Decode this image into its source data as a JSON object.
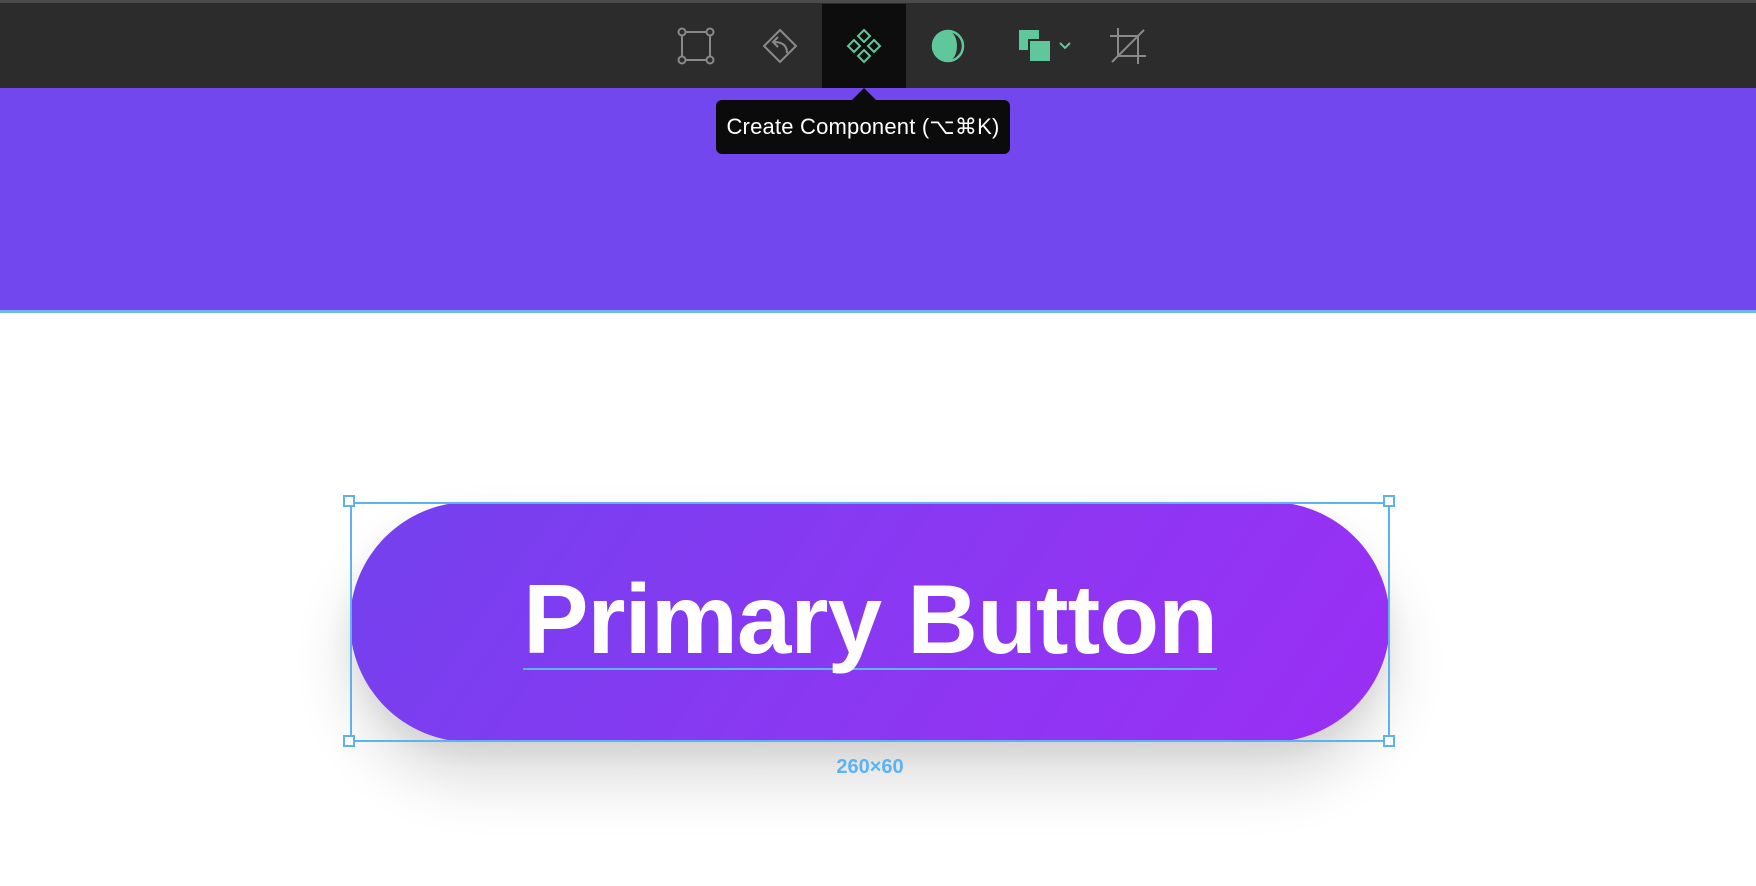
{
  "toolbar": {
    "tools": [
      {
        "name": "frame-tool",
        "icon": "frame-corners-icon",
        "active": false
      },
      {
        "name": "boolean-tool",
        "icon": "undo-diamond-icon",
        "active": false
      },
      {
        "name": "component-tool",
        "icon": "component-diamonds-icon",
        "active": true
      },
      {
        "name": "mask-tool",
        "icon": "contrast-circle-icon",
        "active": false
      },
      {
        "name": "fill-tool",
        "icon": "overlapping-squares-icon",
        "active": false,
        "has_dropdown": true
      },
      {
        "name": "crop-tool",
        "icon": "crop-icon",
        "active": false
      }
    ],
    "active_color": "#5fc79a"
  },
  "tooltip": {
    "text": "Create Component (⌥⌘K)"
  },
  "banner": {
    "color": "#7248ee"
  },
  "component": {
    "label": "Primary Button",
    "gradient_start": "#7341ee",
    "gradient_end": "#9a2ff4"
  },
  "selection": {
    "color": "#5db3f0",
    "dimensions": "260×60"
  }
}
